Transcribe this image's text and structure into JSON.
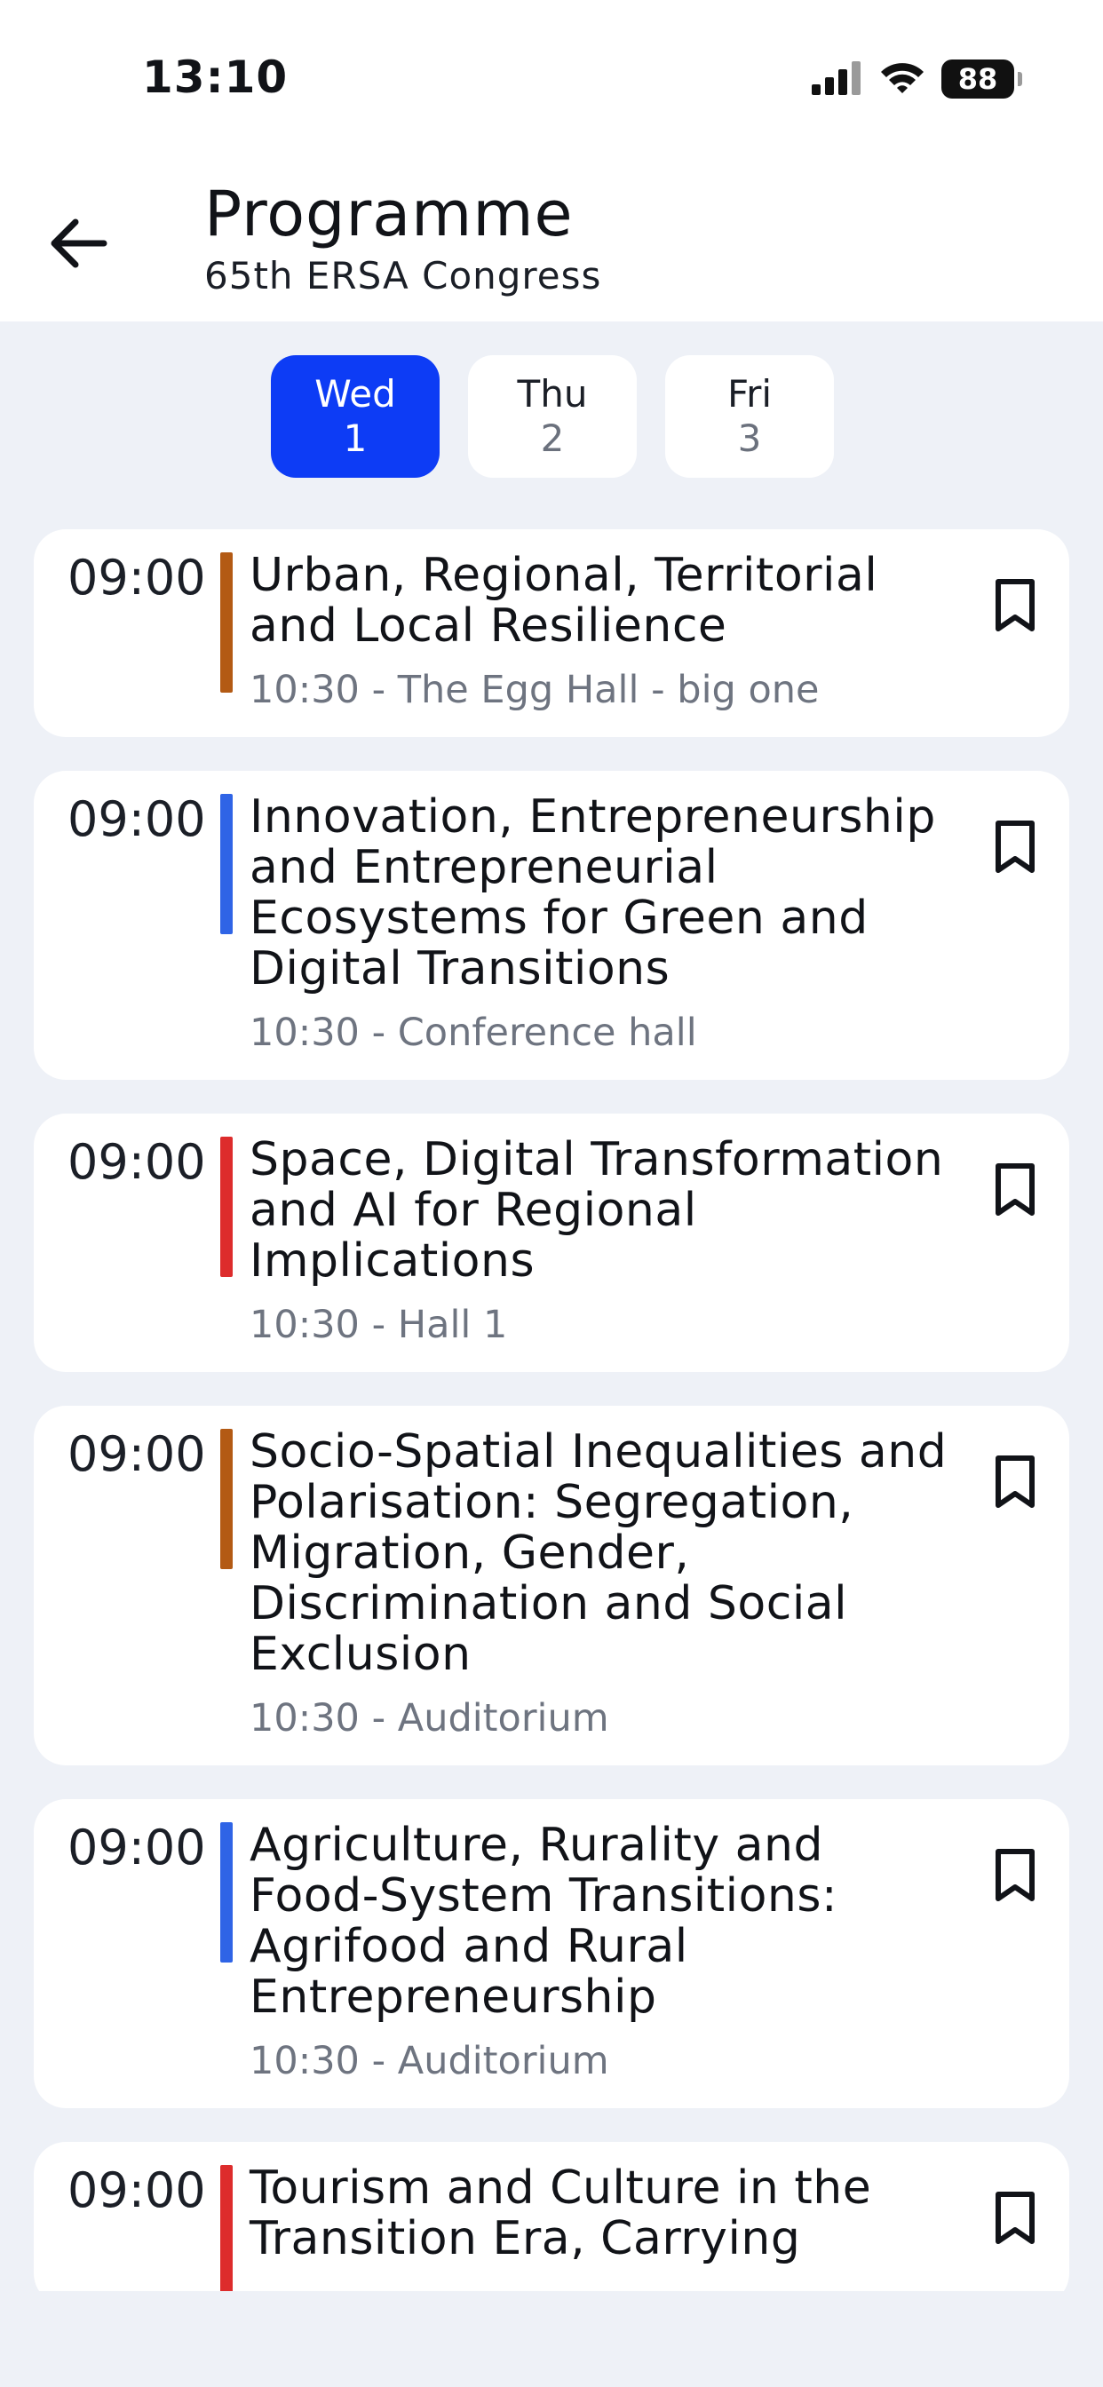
{
  "status_bar": {
    "time": "13:10",
    "battery": "88",
    "icons": [
      "signal-icon",
      "wifi-icon",
      "battery-icon"
    ]
  },
  "header": {
    "title": "Programme",
    "subtitle": "65th ERSA Congress",
    "back_icon": "arrow-left-icon"
  },
  "days": [
    {
      "day": "Wed",
      "num": "1",
      "active": true
    },
    {
      "day": "Thu",
      "num": "2",
      "active": false
    },
    {
      "day": "Fri",
      "num": "3",
      "active": false
    }
  ],
  "colors": {
    "active_tab": "#0d3cf5",
    "orange": "#b35a14",
    "blue": "#2f64e6",
    "red": "#dd2c2c"
  },
  "sessions": [
    {
      "time": "09:00",
      "title": "Urban, Regional, Territorial and Local Resilience",
      "meta": "10:30 - The Egg Hall - big one",
      "color": "#b35a14"
    },
    {
      "time": "09:00",
      "title": "Innovation, Entrepreneurship and Entrepreneurial Ecosystems for Green and Digital Transitions",
      "meta": "10:30 - Conference hall",
      "color": "#2f64e6"
    },
    {
      "time": "09:00",
      "title": "Space, Digital Transformation and AI for Regional Implications",
      "meta": "10:30 - Hall 1",
      "color": "#dd2c2c"
    },
    {
      "time": "09:00",
      "title": "Socio-Spatial Inequalities and Polarisation: Segregation, Migration, Gender, Discrimination and Social Exclusion",
      "meta": "10:30 - Auditorium",
      "color": "#b35a14"
    },
    {
      "time": "09:00",
      "title": "Agriculture, Rurality and Food-System Transitions: Agrifood and Rural Entrepreneurship",
      "meta": "10:30 - Auditorium",
      "color": "#2f64e6"
    },
    {
      "time": "09:00",
      "title": "Tourism and Culture in the Transition Era, Carrying",
      "meta": "",
      "color": "#dd2c2c"
    }
  ]
}
